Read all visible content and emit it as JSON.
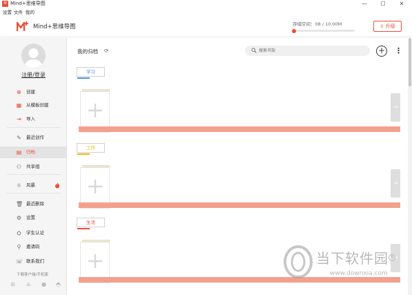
{
  "window": {
    "title": "Mind+思维导图",
    "app_icon_text": "M",
    "minimize_glyph": "—",
    "maximize_glyph": "☐",
    "close_glyph": "✕"
  },
  "menu": [
    "设置",
    "文件",
    "我的"
  ],
  "header": {
    "logo_text": "Mind+思维导图",
    "storage_label": "存储空间：08 / 10.00M",
    "storage_fraction": 0.01,
    "upgrade_label": "升级",
    "accent_color": "#e8503a"
  },
  "sidebar": {
    "login_label": "注册/登录",
    "groups": [
      [
        {
          "icon": "plus-circle-icon",
          "glyph": "⊕",
          "label": "创建"
        },
        {
          "icon": "template-icon",
          "glyph": "▦",
          "label": "从模板创建"
        },
        {
          "icon": "import-icon",
          "glyph": "⇥",
          "label": "导入"
        }
      ],
      [
        {
          "icon": "edit-icon",
          "glyph": "✎",
          "label": "最近创作"
        },
        {
          "icon": "archive-icon",
          "glyph": "▤",
          "label": "归档",
          "active": true
        },
        {
          "icon": "share-group-icon",
          "glyph": "⚇",
          "label": "共享组"
        }
      ],
      [
        {
          "icon": "bulb-icon",
          "glyph": "☼",
          "label": "风暴",
          "hot": true
        }
      ],
      [
        {
          "icon": "trash-icon",
          "glyph": "🗑",
          "label": "最近删除"
        },
        {
          "icon": "gear-icon",
          "glyph": "⚙",
          "label": "设置"
        },
        {
          "icon": "student-icon",
          "glyph": "⛭",
          "label": "学生认证"
        },
        {
          "icon": "user-icon",
          "glyph": "⚲",
          "label": "邀请码"
        },
        {
          "icon": "contact-icon",
          "glyph": "☏",
          "label": "联系我们"
        }
      ]
    ],
    "download_label": "下载客户端/手机版",
    "platform_icons": [
      "windows-icon",
      "appstore-icon",
      "apple-icon",
      "android-icon"
    ]
  },
  "main": {
    "title": "我的归档",
    "search_placeholder": "搜索书架",
    "categories": [
      {
        "label": "学习",
        "color": "#4a90e2"
      },
      {
        "label": "工作",
        "color": "#e6b800"
      },
      {
        "label": "生活",
        "color": "#e8503a"
      }
    ]
  },
  "watermark": {
    "text": "当下软件园",
    "url": "www.downxia.com",
    "reg": "R"
  }
}
